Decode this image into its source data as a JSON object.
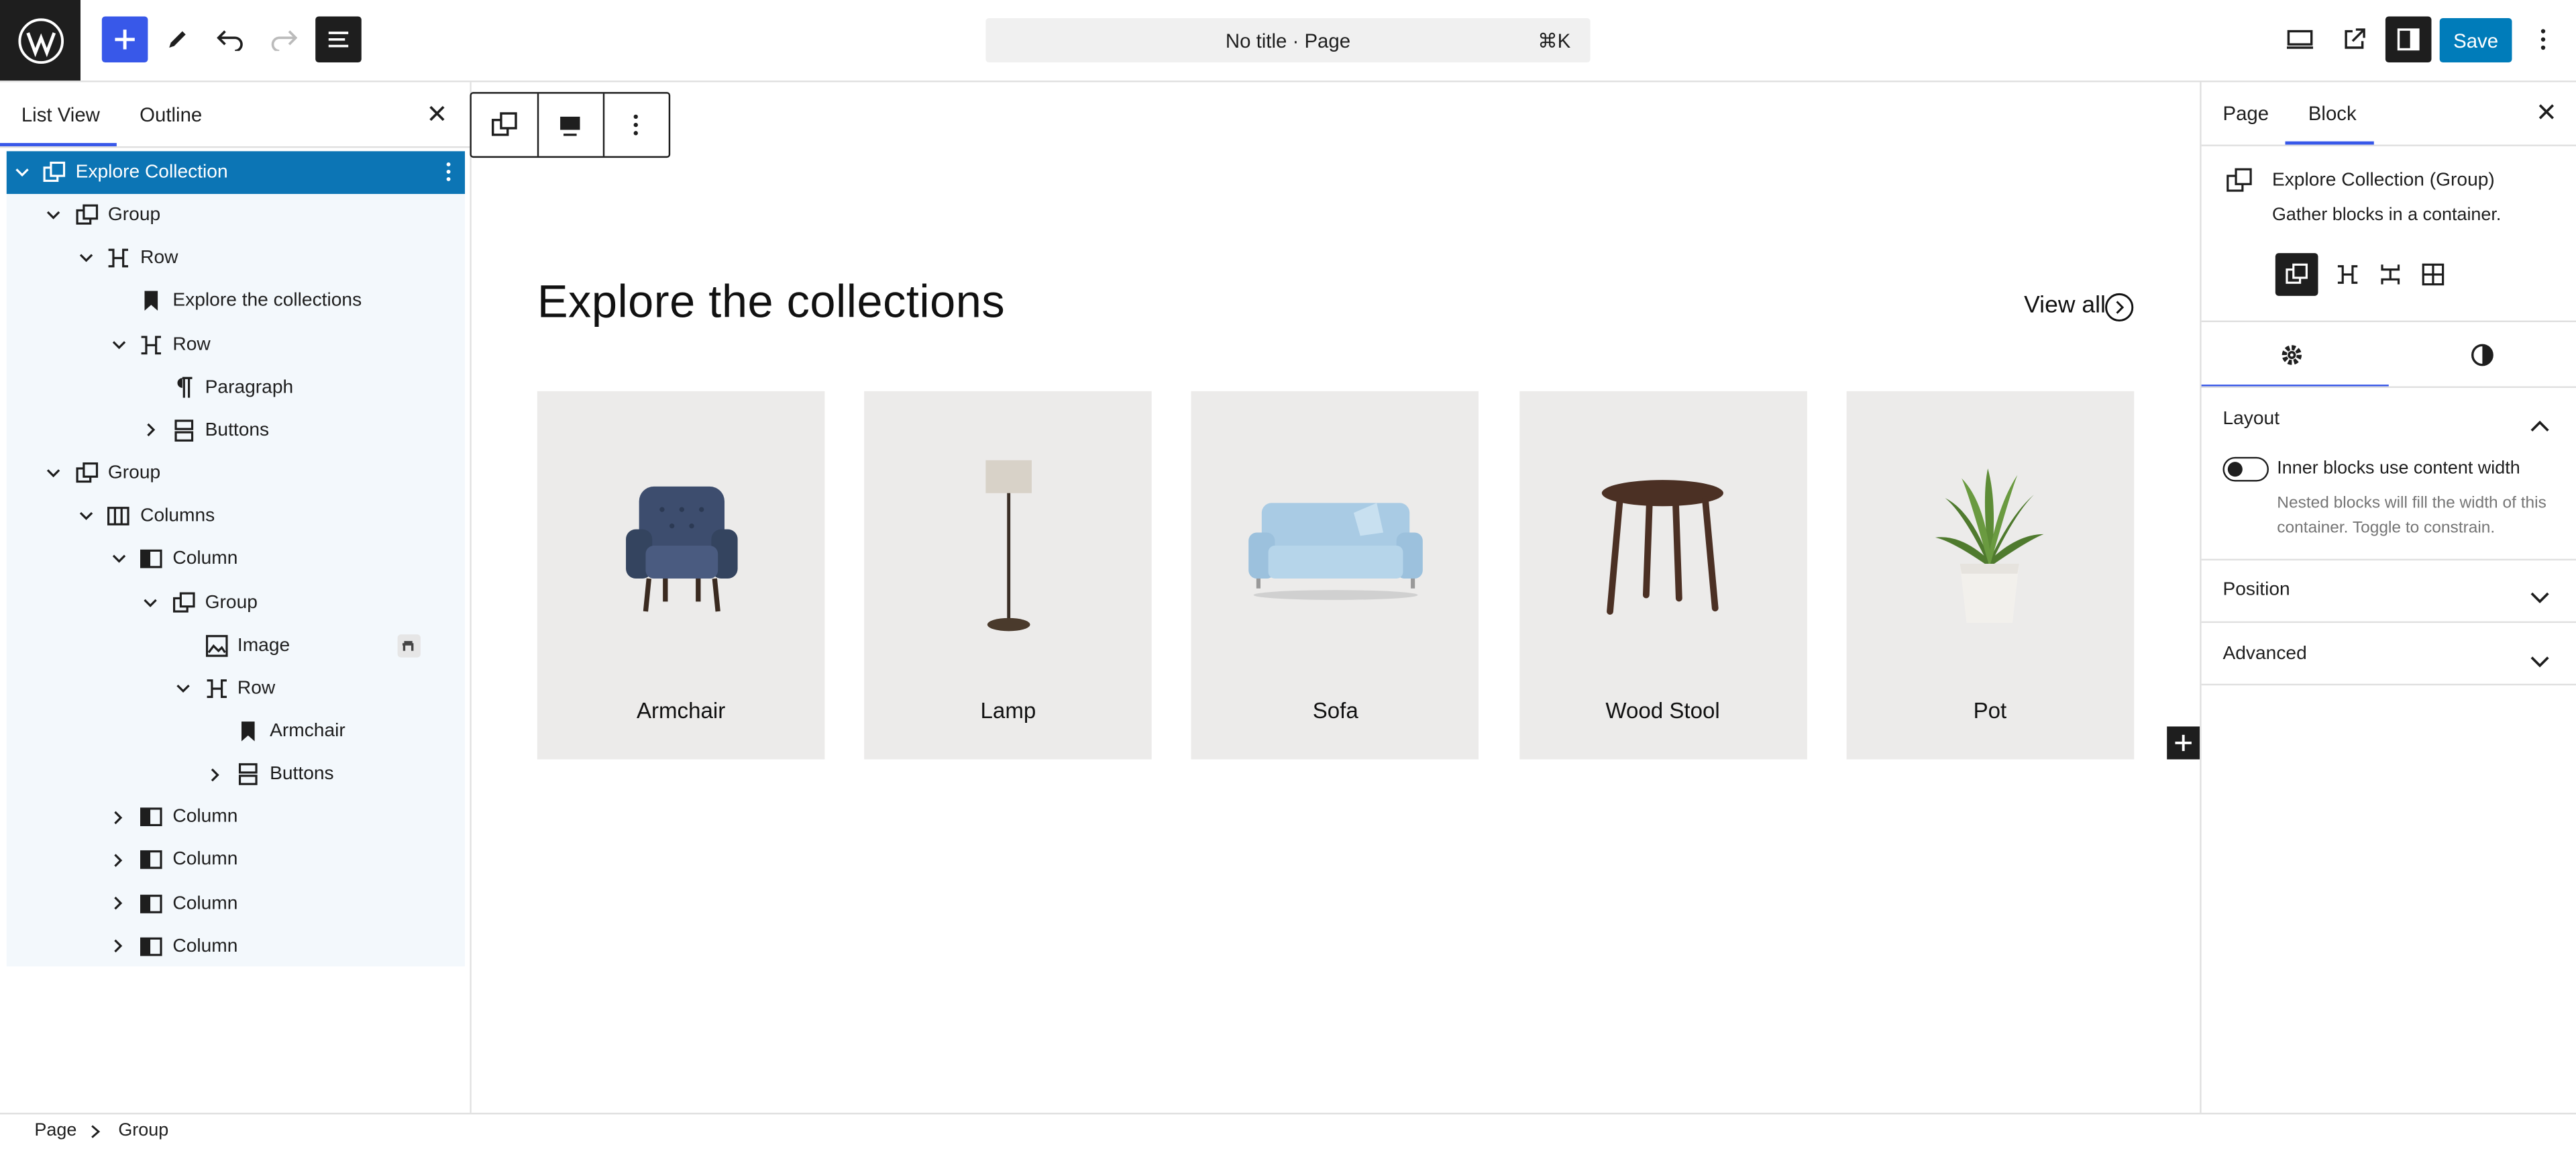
{
  "topbar": {
    "command_title": "No title · Page",
    "command_shortcut": "⌘K",
    "save_label": "Save",
    "icons": [
      "wordpress-logo",
      "add-block-icon",
      "pencil-icon",
      "undo-icon",
      "redo-icon",
      "document-overview-icon",
      "view-desktop-icon",
      "external-preview-icon",
      "sidebar-toggle-icon",
      "kebab-menu-icon"
    ]
  },
  "left_panel": {
    "tabs": [
      "List View",
      "Outline"
    ],
    "tree": [
      {
        "label": "Explore Collection",
        "icon": "group-icon",
        "expander": "down",
        "selected": true
      },
      {
        "label": "Group",
        "icon": "group-icon",
        "expander": "down"
      },
      {
        "label": "Row",
        "icon": "row-icon",
        "expander": "down"
      },
      {
        "label": "Explore the collections",
        "icon": "bookmark-icon",
        "expander": ""
      },
      {
        "label": "Row",
        "icon": "row-icon",
        "expander": "down"
      },
      {
        "label": "Paragraph",
        "icon": "paragraph-icon",
        "expander": ""
      },
      {
        "label": "Buttons",
        "icon": "buttons-icon",
        "expander": "right"
      },
      {
        "label": "Group",
        "icon": "group-icon",
        "expander": "down"
      },
      {
        "label": "Columns",
        "icon": "columns-icon",
        "expander": "down"
      },
      {
        "label": "Column",
        "icon": "column-icon",
        "expander": "down"
      },
      {
        "label": "Group",
        "icon": "group-icon",
        "expander": "down"
      },
      {
        "label": "Image",
        "icon": "image-icon",
        "expander": ""
      },
      {
        "label": "Row",
        "icon": "row-icon",
        "expander": "down"
      },
      {
        "label": "Armchair",
        "icon": "bookmark-icon",
        "expander": ""
      },
      {
        "label": "Buttons",
        "icon": "buttons-icon",
        "expander": "right"
      },
      {
        "label": "Column",
        "icon": "column-icon",
        "expander": "right"
      },
      {
        "label": "Column",
        "icon": "column-icon",
        "expander": "right"
      },
      {
        "label": "Column",
        "icon": "column-icon",
        "expander": "right"
      },
      {
        "label": "Column",
        "icon": "column-icon",
        "expander": "right"
      }
    ]
  },
  "canvas": {
    "heading": "Explore the collections",
    "view_all": "View all",
    "cards": [
      {
        "label": "Armchair",
        "image": "armchair"
      },
      {
        "label": "Lamp",
        "image": "lamp"
      },
      {
        "label": "Sofa",
        "image": "sofa"
      },
      {
        "label": "Wood Stool",
        "image": "wood-stool"
      },
      {
        "label": "Pot",
        "image": "pot"
      }
    ]
  },
  "right_panel": {
    "tabs": [
      "Page",
      "Block"
    ],
    "active_tab": "Block",
    "block_title": "Explore Collection (Group)",
    "block_desc": "Gather blocks in a container.",
    "layout": {
      "title": "Layout",
      "toggle_label": "Inner blocks use content width",
      "toggle_on": false,
      "help": "Nested blocks will fill the width of this container. Toggle to constrain."
    },
    "position_title": "Position",
    "advanced_title": "Advanced"
  },
  "breadcrumb": [
    "Page",
    "Group"
  ],
  "colors": {
    "accent": "#3858e9",
    "selected": "#0c75b5",
    "save": "#007cba",
    "tree_bg": "#f3f8fc",
    "card_bg": "#ecebea"
  }
}
